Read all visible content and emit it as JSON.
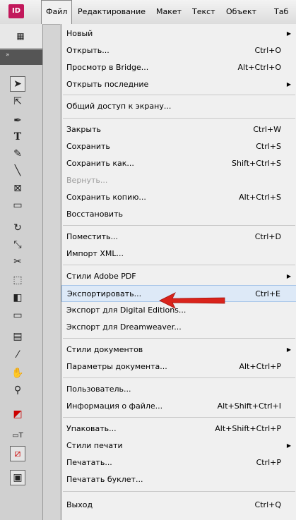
{
  "app": {
    "logo": "ID"
  },
  "menubar": [
    {
      "label": "Файл"
    },
    {
      "label": "Редактирование"
    },
    {
      "label": "Макет"
    },
    {
      "label": "Текст"
    },
    {
      "label": "Объект"
    },
    {
      "label": "Таб"
    }
  ],
  "menu": {
    "items": [
      {
        "label": "Новый",
        "shortcut": "",
        "submenu": true
      },
      {
        "label": "Открыть...",
        "shortcut": "Ctrl+O"
      },
      {
        "label": "Просмотр в Bridge...",
        "shortcut": "Alt+Ctrl+O"
      },
      {
        "label": "Открыть последние",
        "shortcut": "",
        "submenu": true
      },
      {
        "label": "Общий доступ к экрану...",
        "shortcut": ""
      },
      {
        "label": "Закрыть",
        "shortcut": "Ctrl+W"
      },
      {
        "label": "Сохранить",
        "shortcut": "Ctrl+S"
      },
      {
        "label": "Сохранить как...",
        "shortcut": "Shift+Ctrl+S"
      },
      {
        "label": "Вернуть...",
        "shortcut": "",
        "disabled": true
      },
      {
        "label": "Сохранить копию...",
        "shortcut": "Alt+Ctrl+S"
      },
      {
        "label": "Восстановить",
        "shortcut": ""
      },
      {
        "label": "Поместить...",
        "shortcut": "Ctrl+D"
      },
      {
        "label": "Импорт XML...",
        "shortcut": ""
      },
      {
        "label": "Стили Adobe PDF",
        "shortcut": "",
        "submenu": true
      },
      {
        "label": "Экспортировать...",
        "shortcut": "Ctrl+E",
        "highlighted": true
      },
      {
        "label": "Экспорт для Digital Editions...",
        "shortcut": ""
      },
      {
        "label": "Экспорт для Dreamweaver...",
        "shortcut": ""
      },
      {
        "label": "Стили документов",
        "shortcut": "",
        "submenu": true
      },
      {
        "label": "Параметры документа...",
        "shortcut": "Alt+Ctrl+P"
      },
      {
        "label": "Пользователь...",
        "shortcut": ""
      },
      {
        "label": "Информация о файле...",
        "shortcut": "Alt+Shift+Ctrl+I"
      },
      {
        "label": "Упаковать...",
        "shortcut": "Alt+Shift+Ctrl+P"
      },
      {
        "label": "Стили печати",
        "shortcut": "",
        "submenu": true
      },
      {
        "label": "Печатать...",
        "shortcut": "Ctrl+P"
      },
      {
        "label": "Печатать буклет...",
        "shortcut": ""
      },
      {
        "label": "Выход",
        "shortcut": "Ctrl+Q"
      }
    ]
  },
  "colors": {
    "accent_arrow": "#d9231b",
    "highlight": "#dde9f7",
    "app_logo": "#c2185b"
  }
}
